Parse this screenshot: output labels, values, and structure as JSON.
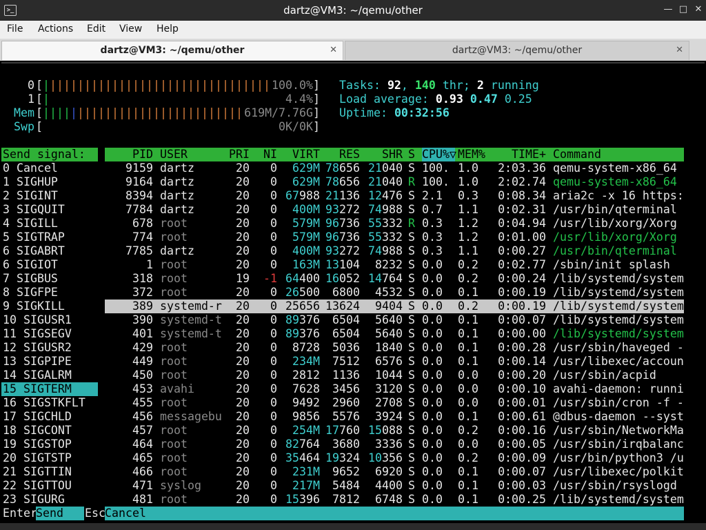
{
  "window": {
    "title": "dartz@VM3: ~/qemu/other",
    "icon_text": ">_"
  },
  "menu": [
    "File",
    "Actions",
    "Edit",
    "View",
    "Help"
  ],
  "tabs": [
    {
      "label": "dartz@VM3: ~/qemu/other",
      "active": true
    },
    {
      "label": "dartz@VM3: ~/qemu/other",
      "active": false
    }
  ],
  "meters": {
    "cpu0": {
      "label": "0",
      "percent": "100.0%",
      "value": 1.0
    },
    "cpu1": {
      "label": "1",
      "percent": "4.4%",
      "value": 0.044
    },
    "mem": {
      "label": "Mem",
      "text": "619M/7.76G",
      "value": 0.08
    },
    "swp": {
      "label": "Swp",
      "text": "0K/0K",
      "value": 0
    }
  },
  "stats": {
    "tasks_label": "Tasks: ",
    "tasks": "92",
    "thr_sep": ", ",
    "threads": "140",
    "thr_label": " thr; ",
    "running": "2",
    "running_label": " running",
    "load_label": "Load average: ",
    "load1": "0.93",
    "load5": "0.47",
    "load15": "0.25",
    "uptime_label": "Uptime: ",
    "uptime": "00:32:56"
  },
  "signal_panel": {
    "header": "Send signal:",
    "selected_index": 15,
    "items": [
      "0 Cancel",
      "1 SIGHUP",
      "2 SIGINT",
      "3 SIGQUIT",
      "4 SIGILL",
      "5 SIGTRAP",
      "6 SIGABRT",
      "6 SIGIOT",
      "7 SIGBUS",
      "8 SIGFPE",
      "9 SIGKILL",
      "10 SIGUSR1",
      "11 SIGSEGV",
      "12 SIGUSR2",
      "13 SIGPIPE",
      "14 SIGALRM",
      "15 SIGTERM",
      "16 SIGSTKFLT",
      "17 SIGCHLD",
      "18 SIGCONT",
      "19 SIGSTOP",
      "20 SIGTSTP",
      "21 SIGTTIN",
      "22 SIGTTOU",
      "23 SIGURG"
    ]
  },
  "columns": [
    "PID",
    "USER",
    "PRI",
    "NI",
    "VIRT",
    "RES",
    "SHR",
    "S",
    "CPU%▽",
    "MEM%",
    "TIME+",
    "Command"
  ],
  "selected_row": 10,
  "processes": [
    {
      "pid": "9159",
      "user": "dartz",
      "pri": "20",
      "ni": "0",
      "virt": "629M",
      "res": "78656",
      "shr": "21040",
      "s": "S",
      "cpu": "100.",
      "mem": "1.0",
      "time": "2:03.36",
      "cmd": "qemu-system-x86_64",
      "green": false,
      "rootuser": false
    },
    {
      "pid": "9164",
      "user": "dartz",
      "pri": "20",
      "ni": "0",
      "virt": "629M",
      "res": "78656",
      "shr": "21040",
      "s": "R",
      "cpu": "100.",
      "mem": "1.0",
      "time": "2:02.74",
      "cmd": "qemu-system-x86_64",
      "green": true,
      "rootuser": false
    },
    {
      "pid": "8394",
      "user": "dartz",
      "pri": "20",
      "ni": "0",
      "virt": "67988",
      "res": "21136",
      "shr": "12476",
      "s": "S",
      "cpu": "2.1",
      "mem": "0.3",
      "time": "0:08.34",
      "cmd": "aria2c -x 16 https:",
      "green": false,
      "rootuser": false
    },
    {
      "pid": "7784",
      "user": "dartz",
      "pri": "20",
      "ni": "0",
      "virt": "400M",
      "res": "93272",
      "shr": "74988",
      "s": "S",
      "cpu": "0.7",
      "mem": "1.1",
      "time": "0:02.31",
      "cmd": "/usr/bin/qterminal",
      "green": false,
      "rootuser": false
    },
    {
      "pid": "678",
      "user": "root",
      "pri": "20",
      "ni": "0",
      "virt": "579M",
      "res": "96736",
      "shr": "55332",
      "s": "R",
      "cpu": "0.3",
      "mem": "1.2",
      "time": "0:04.94",
      "cmd": "/usr/lib/xorg/Xorg",
      "green": false,
      "rootuser": true
    },
    {
      "pid": "774",
      "user": "root",
      "pri": "20",
      "ni": "0",
      "virt": "579M",
      "res": "96736",
      "shr": "55332",
      "s": "S",
      "cpu": "0.3",
      "mem": "1.2",
      "time": "0:01.00",
      "cmd": "/usr/lib/xorg/Xorg",
      "green": true,
      "rootuser": true
    },
    {
      "pid": "7785",
      "user": "dartz",
      "pri": "20",
      "ni": "0",
      "virt": "400M",
      "res": "93272",
      "shr": "74988",
      "s": "S",
      "cpu": "0.3",
      "mem": "1.1",
      "time": "0:00.27",
      "cmd": "/usr/bin/qterminal",
      "green": true,
      "rootuser": false
    },
    {
      "pid": "1",
      "user": "root",
      "pri": "20",
      "ni": "0",
      "virt": "163M",
      "res": "13104",
      "shr": "8232",
      "s": "S",
      "cpu": "0.0",
      "mem": "0.2",
      "time": "0:02.77",
      "cmd": "/sbin/init splash",
      "green": false,
      "rootuser": true
    },
    {
      "pid": "318",
      "user": "root",
      "pri": "19",
      "ni": "-1",
      "virt": "64400",
      "res": "16052",
      "shr": "14764",
      "s": "S",
      "cpu": "0.0",
      "mem": "0.2",
      "time": "0:00.24",
      "cmd": "/lib/systemd/system",
      "green": false,
      "rootuser": true
    },
    {
      "pid": "372",
      "user": "root",
      "pri": "20",
      "ni": "0",
      "virt": "26500",
      "res": "6800",
      "shr": "4532",
      "s": "S",
      "cpu": "0.0",
      "mem": "0.1",
      "time": "0:00.19",
      "cmd": "/lib/systemd/system",
      "green": false,
      "rootuser": true
    },
    {
      "pid": "389",
      "user": "systemd-r",
      "pri": "20",
      "ni": "0",
      "virt": "25656",
      "res": "13624",
      "shr": "9404",
      "s": "S",
      "cpu": "0.0",
      "mem": "0.2",
      "time": "0:00.19",
      "cmd": "/lib/systemd/system",
      "green": false,
      "rootuser": true
    },
    {
      "pid": "390",
      "user": "systemd-t",
      "pri": "20",
      "ni": "0",
      "virt": "89376",
      "res": "6504",
      "shr": "5640",
      "s": "S",
      "cpu": "0.0",
      "mem": "0.1",
      "time": "0:00.07",
      "cmd": "/lib/systemd/system",
      "green": false,
      "rootuser": false
    },
    {
      "pid": "401",
      "user": "systemd-t",
      "pri": "20",
      "ni": "0",
      "virt": "89376",
      "res": "6504",
      "shr": "5640",
      "s": "S",
      "cpu": "0.0",
      "mem": "0.1",
      "time": "0:00.00",
      "cmd": "/lib/systemd/system",
      "green": true,
      "rootuser": true
    },
    {
      "pid": "429",
      "user": "root",
      "pri": "20",
      "ni": "0",
      "virt": "8728",
      "res": "5036",
      "shr": "1840",
      "s": "S",
      "cpu": "0.0",
      "mem": "0.1",
      "time": "0:00.28",
      "cmd": "/usr/sbin/haveged -",
      "green": false,
      "rootuser": true
    },
    {
      "pid": "449",
      "user": "root",
      "pri": "20",
      "ni": "0",
      "virt": "234M",
      "res": "7512",
      "shr": "6576",
      "s": "S",
      "cpu": "0.0",
      "mem": "0.1",
      "time": "0:00.14",
      "cmd": "/usr/libexec/accoun",
      "green": false,
      "rootuser": true
    },
    {
      "pid": "450",
      "user": "root",
      "pri": "20",
      "ni": "0",
      "virt": "2812",
      "res": "1136",
      "shr": "1044",
      "s": "S",
      "cpu": "0.0",
      "mem": "0.0",
      "time": "0:00.20",
      "cmd": "/usr/sbin/acpid",
      "green": false,
      "rootuser": true
    },
    {
      "pid": "453",
      "user": "avahi",
      "pri": "20",
      "ni": "0",
      "virt": "7628",
      "res": "3456",
      "shr": "3120",
      "s": "S",
      "cpu": "0.0",
      "mem": "0.0",
      "time": "0:00.10",
      "cmd": "avahi-daemon: runni",
      "green": false,
      "rootuser": true
    },
    {
      "pid": "455",
      "user": "root",
      "pri": "20",
      "ni": "0",
      "virt": "9492",
      "res": "2960",
      "shr": "2708",
      "s": "S",
      "cpu": "0.0",
      "mem": "0.0",
      "time": "0:00.01",
      "cmd": "/usr/sbin/cron -f -",
      "green": false,
      "rootuser": true
    },
    {
      "pid": "456",
      "user": "messagebu",
      "pri": "20",
      "ni": "0",
      "virt": "9856",
      "res": "5576",
      "shr": "3924",
      "s": "S",
      "cpu": "0.0",
      "mem": "0.1",
      "time": "0:00.61",
      "cmd": "@dbus-daemon --syst",
      "green": false,
      "rootuser": true
    },
    {
      "pid": "457",
      "user": "root",
      "pri": "20",
      "ni": "0",
      "virt": "254M",
      "res": "17760",
      "shr": "15088",
      "s": "S",
      "cpu": "0.0",
      "mem": "0.2",
      "time": "0:00.16",
      "cmd": "/usr/sbin/NetworkMa",
      "green": false,
      "rootuser": true
    },
    {
      "pid": "464",
      "user": "root",
      "pri": "20",
      "ni": "0",
      "virt": "82764",
      "res": "3680",
      "shr": "3336",
      "s": "S",
      "cpu": "0.0",
      "mem": "0.0",
      "time": "0:00.05",
      "cmd": "/usr/sbin/irqbalanc",
      "green": false,
      "rootuser": true
    },
    {
      "pid": "465",
      "user": "root",
      "pri": "20",
      "ni": "0",
      "virt": "35464",
      "res": "19324",
      "shr": "10356",
      "s": "S",
      "cpu": "0.0",
      "mem": "0.2",
      "time": "0:00.09",
      "cmd": "/usr/bin/python3 /u",
      "green": false,
      "rootuser": true
    },
    {
      "pid": "466",
      "user": "root",
      "pri": "20",
      "ni": "0",
      "virt": "231M",
      "res": "9652",
      "shr": "6920",
      "s": "S",
      "cpu": "0.0",
      "mem": "0.1",
      "time": "0:00.07",
      "cmd": "/usr/libexec/polkit",
      "green": false,
      "rootuser": true
    },
    {
      "pid": "471",
      "user": "syslog",
      "pri": "20",
      "ni": "0",
      "virt": "217M",
      "res": "5484",
      "shr": "4400",
      "s": "S",
      "cpu": "0.0",
      "mem": "0.1",
      "time": "0:00.03",
      "cmd": "/usr/sbin/rsyslogd",
      "green": false,
      "rootuser": false
    },
    {
      "pid": "481",
      "user": "root",
      "pri": "20",
      "ni": "0",
      "virt": "15396",
      "res": "7812",
      "shr": "6748",
      "s": "S",
      "cpu": "0.0",
      "mem": "0.1",
      "time": "0:00.25",
      "cmd": "/lib/systemd/system",
      "green": false,
      "rootuser": true
    }
  ],
  "footer": {
    "k1": "Enter",
    "l1": "Send",
    "k2": "Esc",
    "l2": "Cancel"
  }
}
